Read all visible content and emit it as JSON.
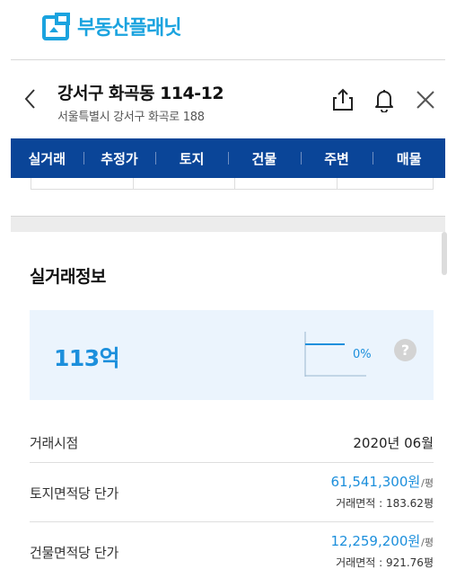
{
  "brand": {
    "name": "부동산플래닛",
    "accent": "#1aa3df"
  },
  "header": {
    "title": "강서구 화곡동 114-12",
    "subtitle": "서울특별시 강서구 화곡로 188"
  },
  "tabs": [
    {
      "label": "실거래"
    },
    {
      "label": "추정가"
    },
    {
      "label": "토지"
    },
    {
      "label": "건물"
    },
    {
      "label": "주변"
    },
    {
      "label": "매물"
    }
  ],
  "colors": {
    "tab_bar": "#0a4598",
    "price_blue": "#1c8fdc",
    "summary_bg": "#ebf4fd"
  },
  "section": {
    "title": "실거래정보"
  },
  "summary": {
    "price": "113억",
    "change_pct": "0%",
    "help_label": "?"
  },
  "rows": [
    {
      "label": "거래시점",
      "value": "2020년 06월"
    },
    {
      "label": "토지면적당 단가",
      "value": "61,541,300원",
      "unit": "/평",
      "sub": "거래면적 : 183.62평"
    },
    {
      "label": "건물면적당 단가",
      "value": "12,259,200원",
      "unit": "/평",
      "sub": "거래면적 : 921.76평"
    }
  ]
}
